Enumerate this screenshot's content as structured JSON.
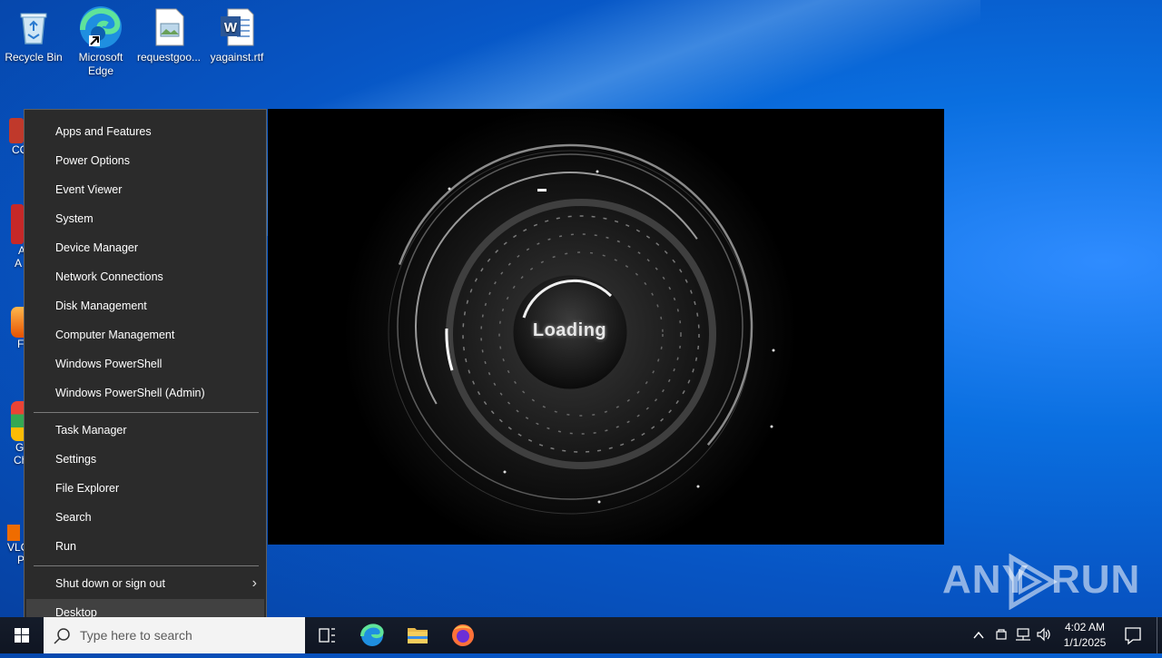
{
  "desktop": {
    "icons": [
      {
        "label": "Recycle Bin"
      },
      {
        "label": "Microsoft Edge"
      },
      {
        "label": "requestgoo..."
      },
      {
        "label": "yagainst.rtf"
      }
    ],
    "partial_labels": [
      "CC",
      "A",
      "A",
      "F",
      "G",
      "Ch",
      "VLC",
      "P"
    ]
  },
  "loading_window": {
    "text": "Loading"
  },
  "watermark": {
    "text": "ANY",
    "text2": "RUN"
  },
  "context_menu": {
    "group1": [
      "Apps and Features",
      "Power Options",
      "Event Viewer",
      "System",
      "Device Manager",
      "Network Connections",
      "Disk Management",
      "Computer Management",
      "Windows PowerShell",
      "Windows PowerShell (Admin)"
    ],
    "group2": [
      "Task Manager",
      "Settings",
      "File Explorer",
      "Search",
      "Run"
    ],
    "group3": {
      "shutdown": "Shut down or sign out",
      "desktop": "Desktop"
    }
  },
  "taskbar": {
    "search_placeholder": "Type here to search",
    "time": "4:02 AM",
    "date": "1/1/2025"
  },
  "colors": {
    "menu_bg": "#2b2b2b",
    "menu_hover": "#414141",
    "taskbar": "#101828"
  }
}
